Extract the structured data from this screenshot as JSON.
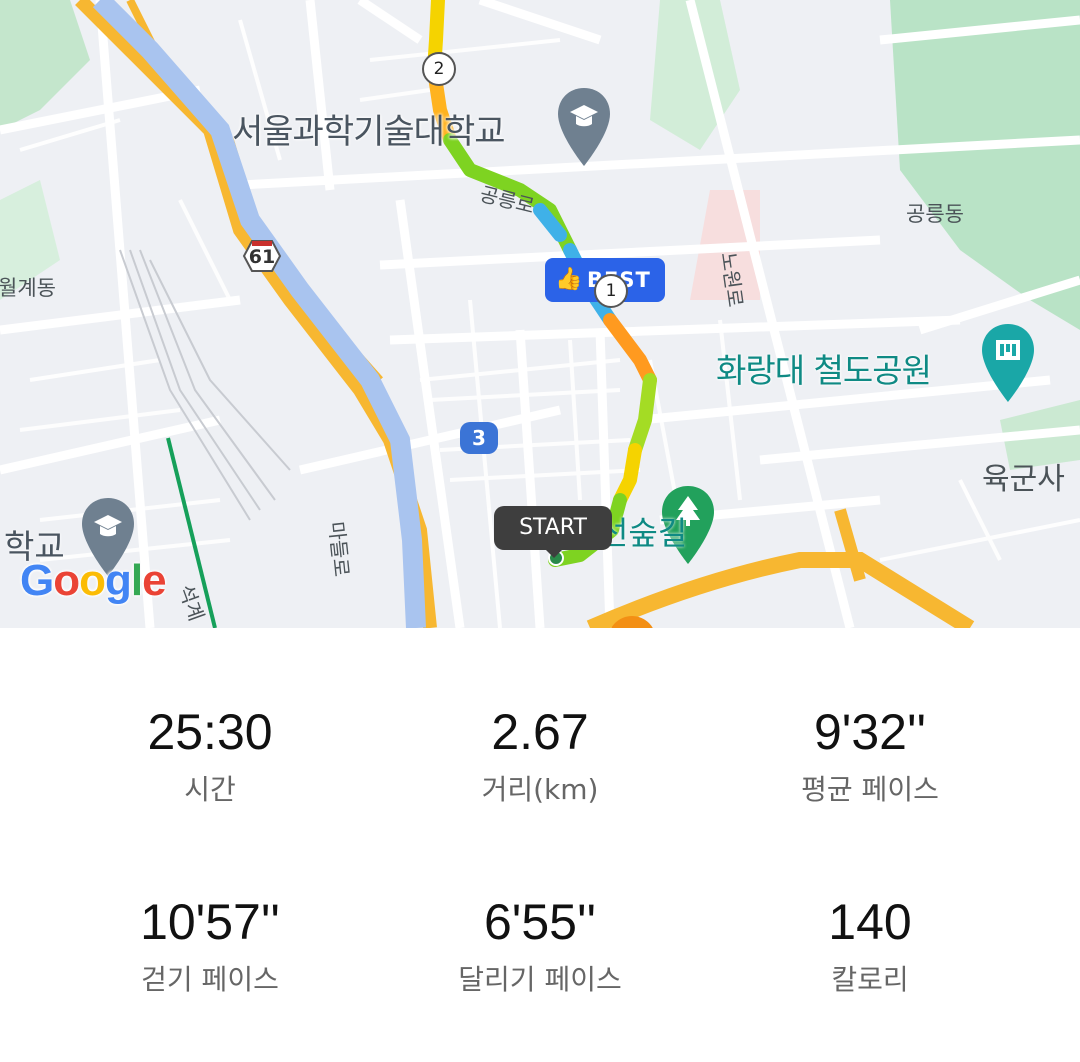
{
  "map": {
    "labels": {
      "school": "서울과학기술대학교",
      "park": "화랑대 철도공원",
      "dong_right": "공릉동",
      "dong_left": "월계동",
      "army": "육군사",
      "school_left": "학교",
      "street": "경춘선숲길",
      "road_gongneung": "공릉로",
      "road_nowon": "노원로",
      "road_madeul": "마들로",
      "road_seokgye": "석계"
    },
    "route_number": "61",
    "circle_marker": "3",
    "best_label": "BEST",
    "km_markers": [
      "1",
      "2"
    ],
    "start_label": "START",
    "google": [
      "G",
      "o",
      "o",
      "g",
      "l",
      "e"
    ],
    "colors": {
      "route_green": "#7ed321",
      "route_yellow": "#f5d300",
      "route_orange": "#ff9a1f",
      "route_blue": "#3fb1e8",
      "highway": "#f7b731",
      "river": "#a9c4ef",
      "park_green": "#b9e3c6",
      "best_badge": "#2b63e8"
    },
    "icons": {
      "school": "graduation-cap-icon",
      "museum": "museum-icon",
      "forest": "tree-icon",
      "best": "thumbs-up-icon"
    }
  },
  "stats": [
    {
      "value": "25:30",
      "label": "시간"
    },
    {
      "value": "2.67",
      "label": "거리(km)"
    },
    {
      "value": "9'32''",
      "label": "평균 페이스"
    },
    {
      "value": "10'57''",
      "label": "걷기 페이스"
    },
    {
      "value": "6'55''",
      "label": "달리기 페이스"
    },
    {
      "value": "140",
      "label": "칼로리"
    }
  ]
}
